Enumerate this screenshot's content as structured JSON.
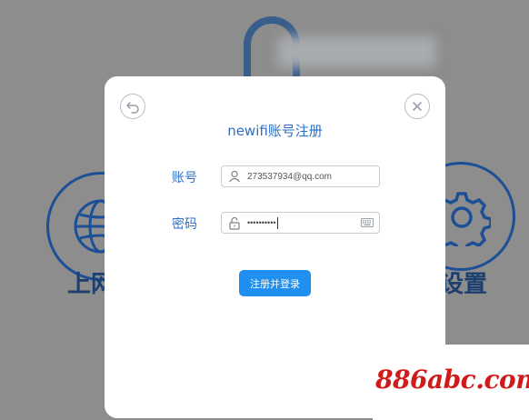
{
  "background": {
    "left_label": "上网",
    "right_label": "设置"
  },
  "modal": {
    "title": "newifi账号注册",
    "back_icon": "back-arrow-icon",
    "close_icon": "close-icon",
    "account": {
      "label": "账号",
      "value": "273537934@qq.com",
      "icon": "user-icon"
    },
    "password": {
      "label": "密码",
      "value": "••••••••••",
      "icon": "lock-icon",
      "keyboard_icon": "keyboard-icon"
    },
    "submit_label": "注册并登录"
  },
  "watermark": {
    "text": "886abc.com"
  },
  "colors": {
    "accent": "#2e6fc6",
    "button": "#1f8ff0",
    "overlay": "#8d8d8d",
    "watermark": "#d11a1a"
  }
}
